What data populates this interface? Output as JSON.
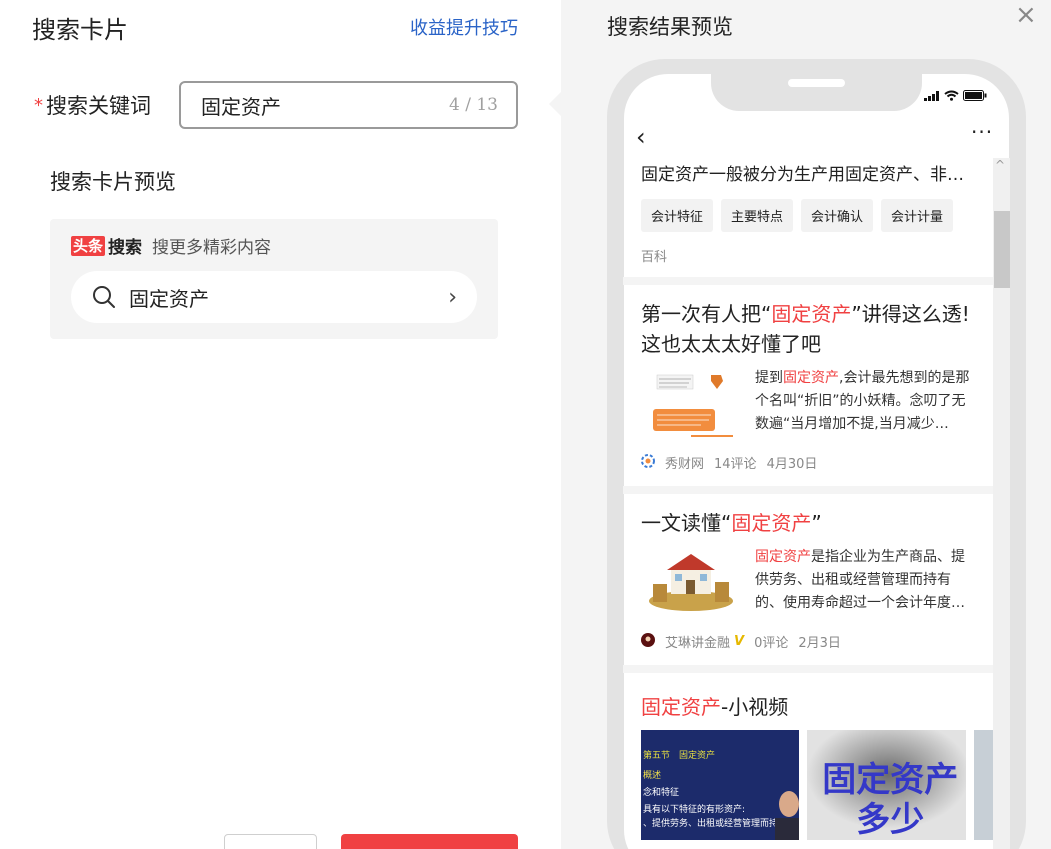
{
  "left": {
    "title": "搜索卡片",
    "tips_link": "收益提升技巧",
    "keyword": {
      "required_mark": "*",
      "label": "搜索关键词",
      "value": "固定资产",
      "counter": "4 / 13"
    },
    "preview_label": "搜索卡片预览",
    "card": {
      "brand_box": "头条",
      "brand_text": "搜索",
      "slogan": "搜更多精彩内容",
      "search_text": "固定资产",
      "chevron": "›"
    }
  },
  "right": {
    "title": "搜索结果预览",
    "close": "×",
    "nav": {
      "back": "‹",
      "more": "···"
    },
    "baike": {
      "text": "固定资产一般被分为生产用固定资产、非生产用固定资产",
      "tags": [
        "会计特征",
        "主要特点",
        "会计确认",
        "会计计量"
      ],
      "source": "百科"
    },
    "articles": [
      {
        "title_pre": "第一次有人把“",
        "title_hl": "固定资产",
        "title_post": "”讲得这么透!这也太太太好懂了吧",
        "text_pre": "提到",
        "text_hl": "固定资产",
        "text_post": ",会计最先想到的是那个名叫“折旧”的小妖精。念叨了无数遍“当月增加不提,当月减少…",
        "source": "秀财网",
        "comments": "14评论",
        "date": "4月30日",
        "verified": ""
      },
      {
        "title_pre": "一文读懂“",
        "title_hl": "固定资产",
        "title_post": "”",
        "text_pre": "",
        "text_hl": "固定资产",
        "text_post": "是指企业为生产商品、提供劳务、出租或经营管理而持有的、使用寿命超过一个会计年度…",
        "source": "艾琳讲金融",
        "comments": "0评论",
        "date": "2月3日",
        "verified": "V"
      }
    ],
    "video_section": {
      "title_hl": "固定资产",
      "title_post": "-小视频",
      "video1_lines": [
        "第五节　固定资产",
        "概述",
        "念和特征",
        "具有以下特征的有形资产:",
        "、提供劳务、出租或经营管理而持有的;"
      ],
      "video2_caption": "固定资产多少"
    }
  },
  "colors": {
    "accent_red": "#f04142",
    "link_blue": "#2a63c7",
    "panel_gray": "#f4f4f4"
  }
}
